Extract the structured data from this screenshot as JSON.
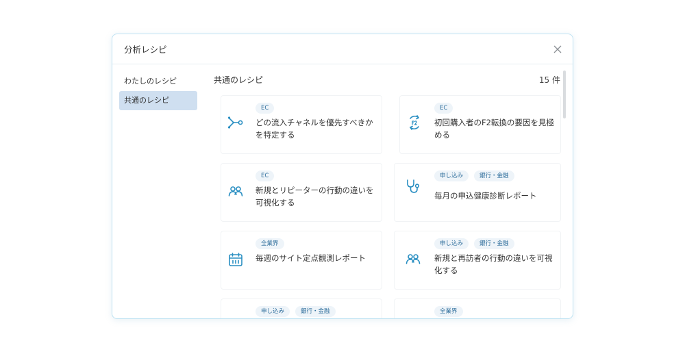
{
  "dialog": {
    "title": "分析レシピ",
    "close_label": "×"
  },
  "sidebar": {
    "items": [
      {
        "label": "わたしのレシピ"
      },
      {
        "label": "共通のレシピ"
      }
    ]
  },
  "content": {
    "section_title": "共通のレシピ",
    "count": "15 件"
  },
  "recipes": [
    {
      "tags": [
        "EC"
      ],
      "title": "どの流入チャネルを優先すべきかを特定する",
      "icon": "channel-split-icon"
    },
    {
      "tags": [
        "EC"
      ],
      "title": "初回購入者のF2転換の要因を見極める",
      "icon": "f2-conversion-icon"
    },
    {
      "tags": [
        "EC"
      ],
      "title": "新規とリピーターの行動の違いを可視化する",
      "icon": "users-icon"
    },
    {
      "tags": [
        "申し込み",
        "銀行・金融"
      ],
      "title": "毎月の申込健康診断レポート",
      "icon": "stethoscope-icon"
    },
    {
      "tags": [
        "全業界"
      ],
      "title": "毎週のサイト定点観測レポート",
      "icon": "calendar-icon"
    },
    {
      "tags": [
        "申し込み",
        "銀行・金融"
      ],
      "title": "新規と再訪者の行動の違いを可視化する",
      "icon": "users-icon"
    },
    {
      "tags": [
        "申し込み",
        "銀行・金融"
      ],
      "title": "",
      "icon": ""
    },
    {
      "tags": [
        "全業界"
      ],
      "title": "",
      "icon": ""
    }
  ],
  "colors": {
    "accent": "#2a8fc2",
    "active_nav": "#cfdff0",
    "tag_bg": "#eef4f9",
    "tag_text": "#2f6e9c"
  }
}
